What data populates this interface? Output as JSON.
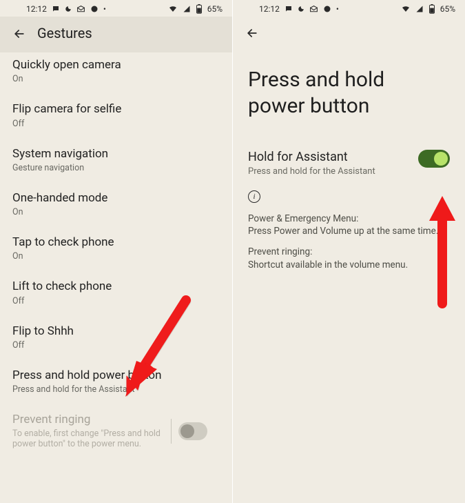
{
  "status": {
    "time": "12:12",
    "battery": "65%"
  },
  "left": {
    "header_title": "Gestures",
    "items": [
      {
        "title": "Quickly open camera",
        "sub": "On"
      },
      {
        "title": "Flip camera for selfie",
        "sub": "Off"
      },
      {
        "title": "System navigation",
        "sub": "Gesture navigation"
      },
      {
        "title": "One-handed mode",
        "sub": "On"
      },
      {
        "title": "Tap to check phone",
        "sub": "On"
      },
      {
        "title": "Lift to check phone",
        "sub": "Off"
      },
      {
        "title": "Flip to Shhh",
        "sub": "Off"
      },
      {
        "title": "Press and hold power button",
        "sub": "Press and hold for the Assistant"
      }
    ],
    "disabled": {
      "title": "Prevent ringing",
      "sub": "To enable, first change \"Press and hold power button\" to the power menu."
    }
  },
  "right": {
    "big_title_line1": "Press and hold",
    "big_title_line2": "power button",
    "setting": {
      "title": "Hold for Assistant",
      "sub": "Press and hold for the Assistant"
    },
    "info1_label": "Power & Emergency Menu:",
    "info1_body": "Press Power and Volume up at the same time.",
    "info2_label": "Prevent ringing:",
    "info2_body": "Shortcut available in the volume menu."
  }
}
